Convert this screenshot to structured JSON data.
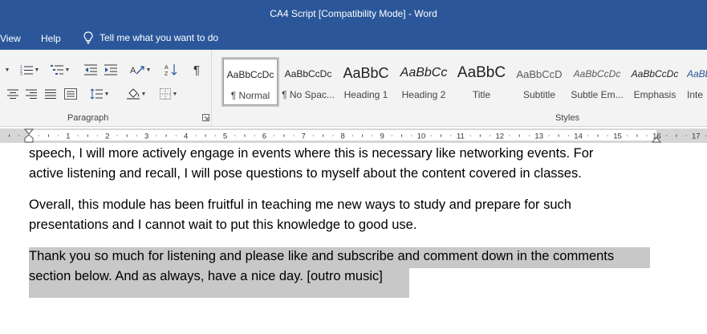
{
  "window": {
    "title": "CA4 Script [Compatibility Mode]  -  Word"
  },
  "menu": {
    "items": [
      "View",
      "Help"
    ],
    "tell_me": "Tell me what you want to do"
  },
  "ribbon": {
    "paragraph_group_label": "Paragraph",
    "styles_group_label": "Styles",
    "styles": [
      {
        "sample": "AaBbCcDc",
        "name": "¶ Normal",
        "selected": true
      },
      {
        "sample": "AaBbCcDc",
        "name": "¶ No Spac..."
      },
      {
        "sample": "AaBbC",
        "name": "Heading 1"
      },
      {
        "sample": "AaBbCc",
        "name": "Heading 2"
      },
      {
        "sample": "AaBbC",
        "name": "Title"
      },
      {
        "sample": "AaBbCcD",
        "name": "Subtitle"
      },
      {
        "sample": "AaBbCcDc",
        "name": "Subtle Em..."
      },
      {
        "sample": "AaBbCcDc",
        "name": "Emphasis"
      },
      {
        "sample": "AaBb",
        "name": "Inte"
      }
    ]
  },
  "ruler": {
    "numbers": [
      "1",
      "2",
      "3",
      "4",
      "5",
      "6",
      "7",
      "8",
      "9",
      "10",
      "11",
      "12",
      "13",
      "14",
      "15",
      "16",
      "17"
    ]
  },
  "document": {
    "para1_line1": "speech, I will more actively engage in events where this is necessary like networking events. For",
    "para1_line2": "active listening and recall, I will pose questions to myself about the content covered in classes.",
    "para2_line1": "Overall, this module has been fruitful in teaching me new ways to study and prepare for such",
    "para2_line2": "presentations and I cannot wait to put this knowledge to good use.",
    "para3_line1": "Thank you so much for listening and please like and subscribe and comment down in the comments",
    "para3_line2": "section below. And as always, have a nice day. [outro music]"
  },
  "colors": {
    "brand": "#2b579a",
    "selection": "#c8c8c8",
    "ribbon_bg": "#f3f3f3"
  }
}
